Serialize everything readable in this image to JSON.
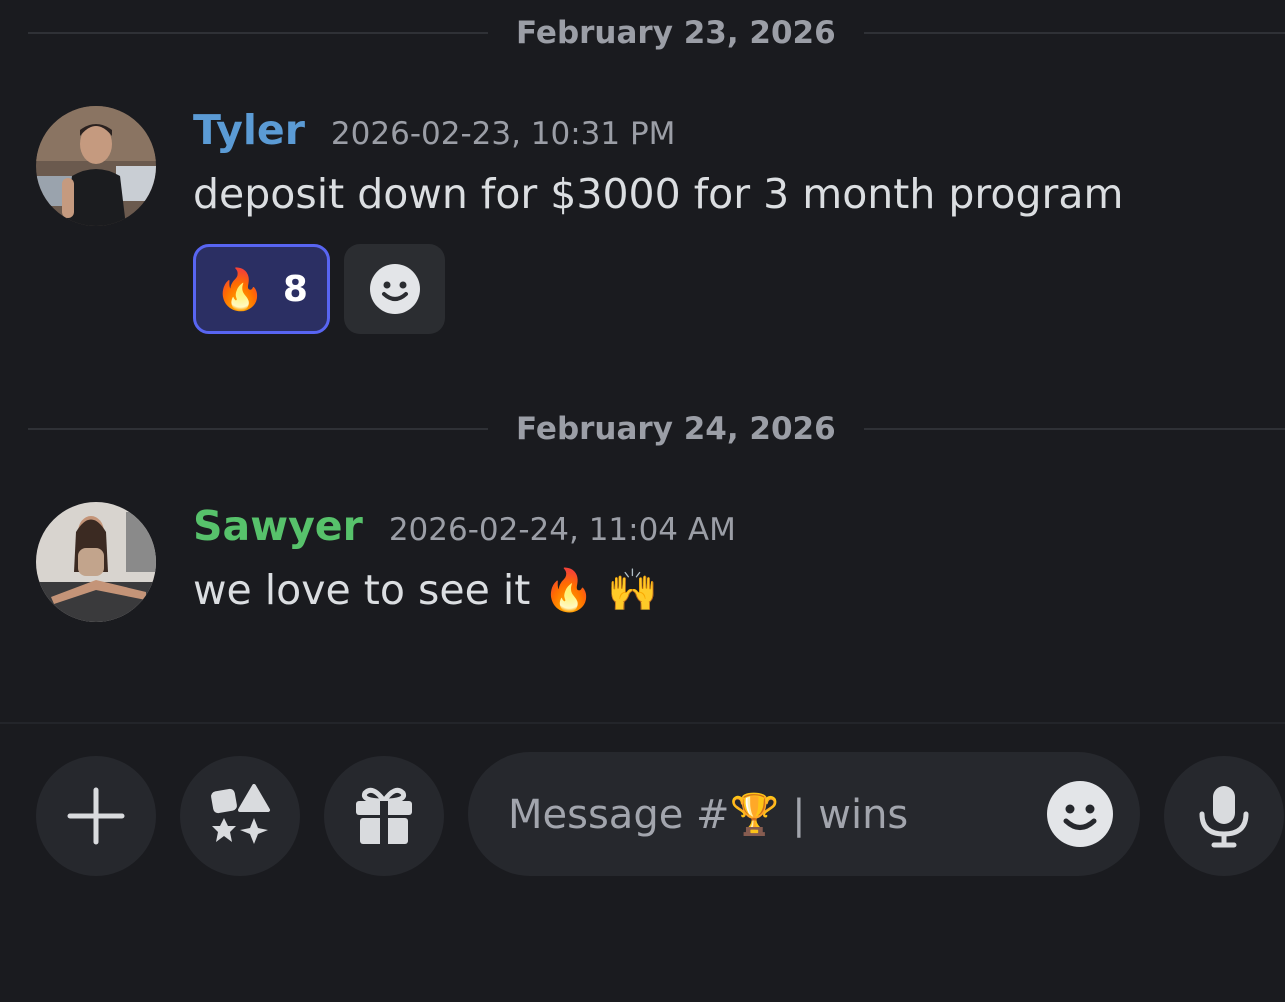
{
  "dividers": [
    "February 23, 2026",
    "February 24, 2026"
  ],
  "messages": [
    {
      "username": "Tyler",
      "username_color": "#5b9bd5",
      "timestamp": "2026-02-23, 10:31 PM",
      "content": "deposit down for $3000 for 3 month program",
      "reactions": [
        {
          "emoji": "🔥",
          "count": "8"
        }
      ]
    },
    {
      "username": "Sawyer",
      "username_color": "#57c26b",
      "timestamp": "2026-02-24, 11:04 AM",
      "content": "we love to see it 🔥 🙌"
    }
  ],
  "composer": {
    "placeholder": "Message #🏆 | wins",
    "buttons": [
      "plus-icon",
      "apps-icon",
      "gift-icon",
      "microphone-icon"
    ]
  },
  "colors": {
    "background": "#1a1b1f",
    "accent": "#5865f2",
    "reaction_active_bg": "#2b2f63"
  }
}
